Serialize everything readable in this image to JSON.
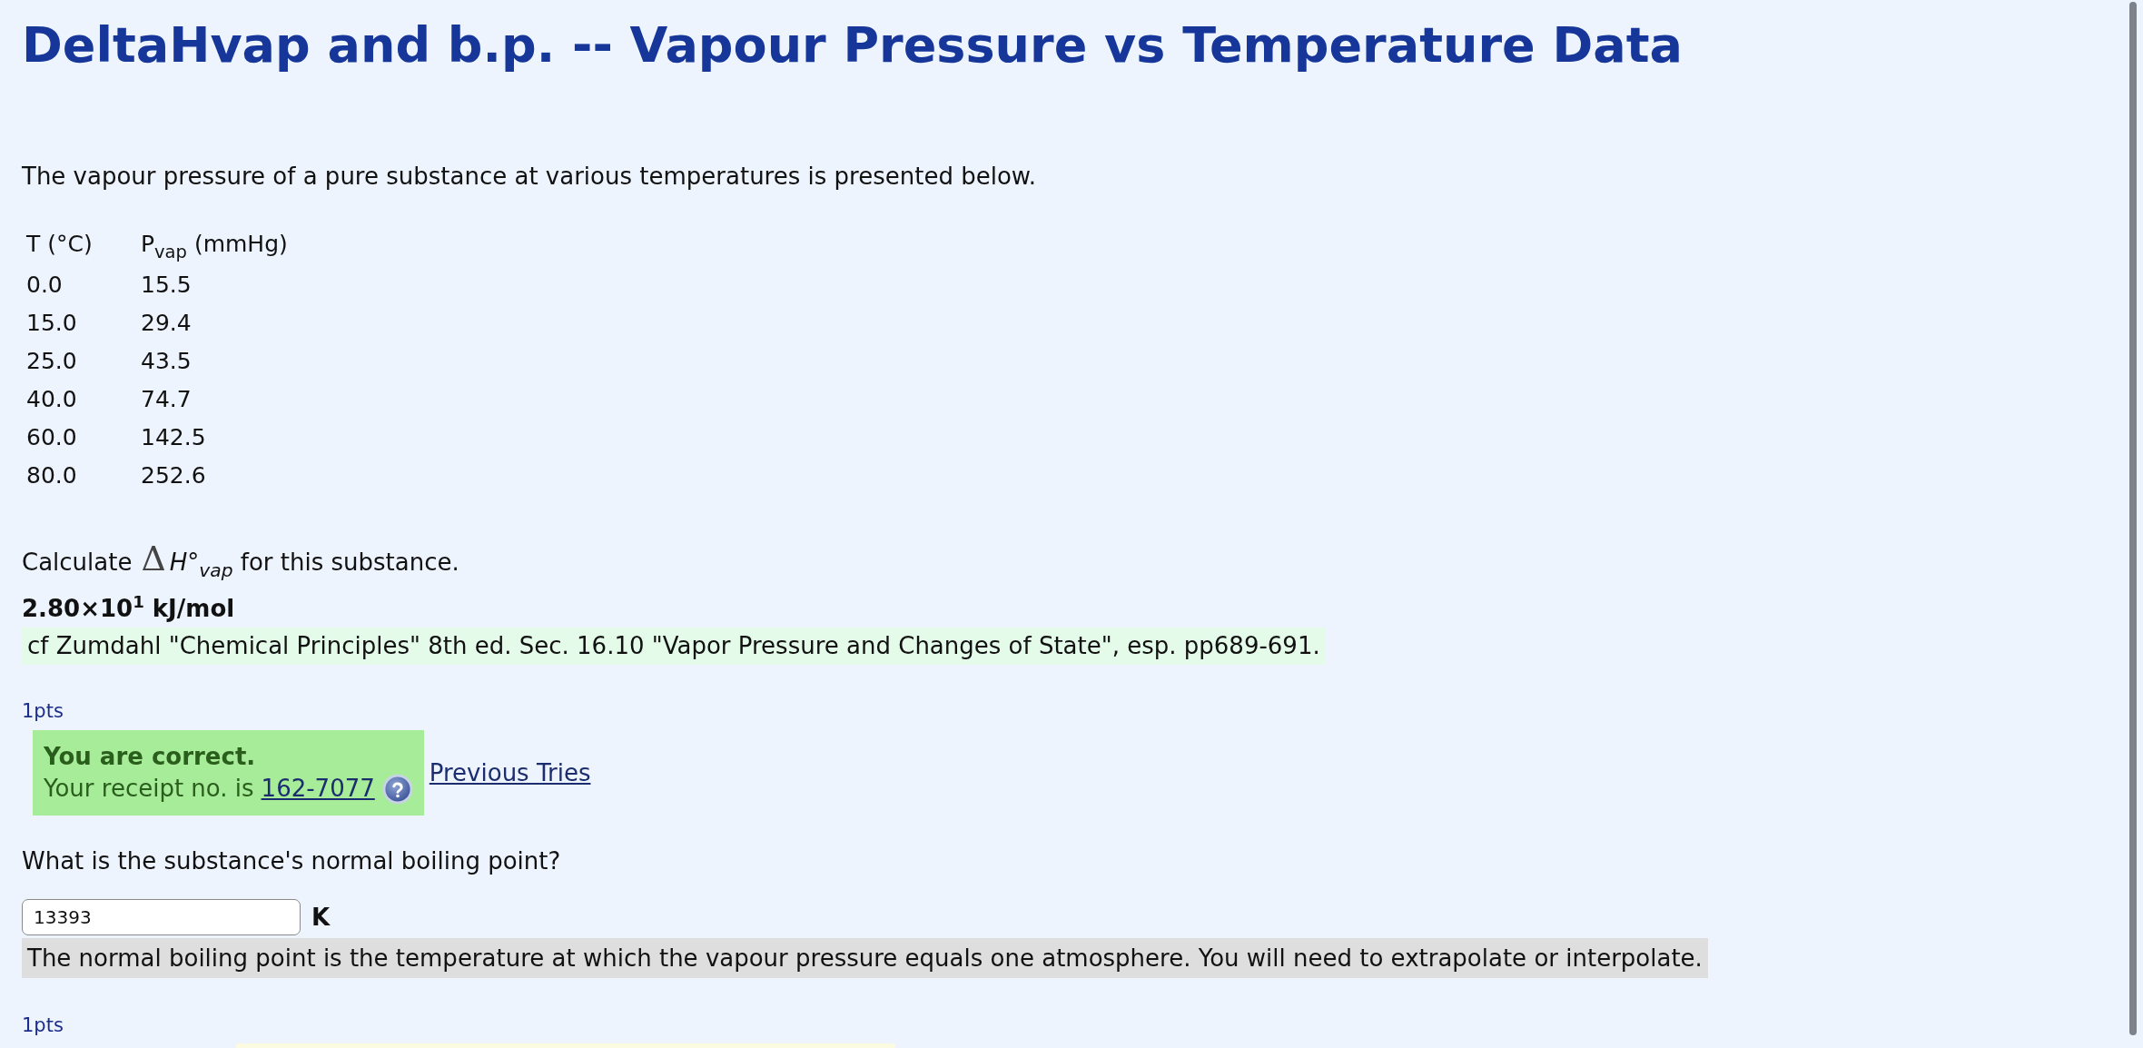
{
  "page": {
    "title": "DeltaHvap and b.p. -- Vapour Pressure vs Temperature Data"
  },
  "intro": "The vapour pressure of a pure substance at various temperatures is presented below.",
  "data_table": {
    "columns": [
      "T (°C)",
      "P$_{vap}$ (mmHg)"
    ],
    "rows": [
      [
        "0.0",
        "15.5"
      ],
      [
        "15.0",
        "29.4"
      ],
      [
        "25.0",
        "43.5"
      ],
      [
        "40.0",
        "74.7"
      ],
      [
        "60.0",
        "142.5"
      ],
      [
        "80.0",
        "252.6"
      ]
    ]
  },
  "questions": [
    {
      "kind": "calculation",
      "prompt": {
        "lead": "Calculate",
        "symbol": "Δ",
        "quantity": "H°",
        "subscript": "vap",
        "tail": "for this substance."
      },
      "answer": "2.80×10$^{1}$ kJ/mol",
      "reference": "cf Zumdahl \"Chemical Principles\" 8th ed. Sec. 16.10 \"Vapor Pressure and Changes of State\", esp. pp689-691.",
      "points": "1pts",
      "feedback": {
        "correct": true,
        "message": "You are correct.",
        "receipt_label": "Your receipt no. is",
        "receipt_number": "162-7077",
        "link": "Previous Tries"
      }
    },
    {
      "kind": "entry",
      "prompt": "What is the substance's normal boiling point?",
      "input": {
        "value": "13393"
      },
      "unit": "K",
      "hint": "The normal boiling point is the temperature at which the vapour pressure equals one atmosphere. You will need to extrapolate or interpolate.",
      "points": "1pts"
    }
  ]
}
